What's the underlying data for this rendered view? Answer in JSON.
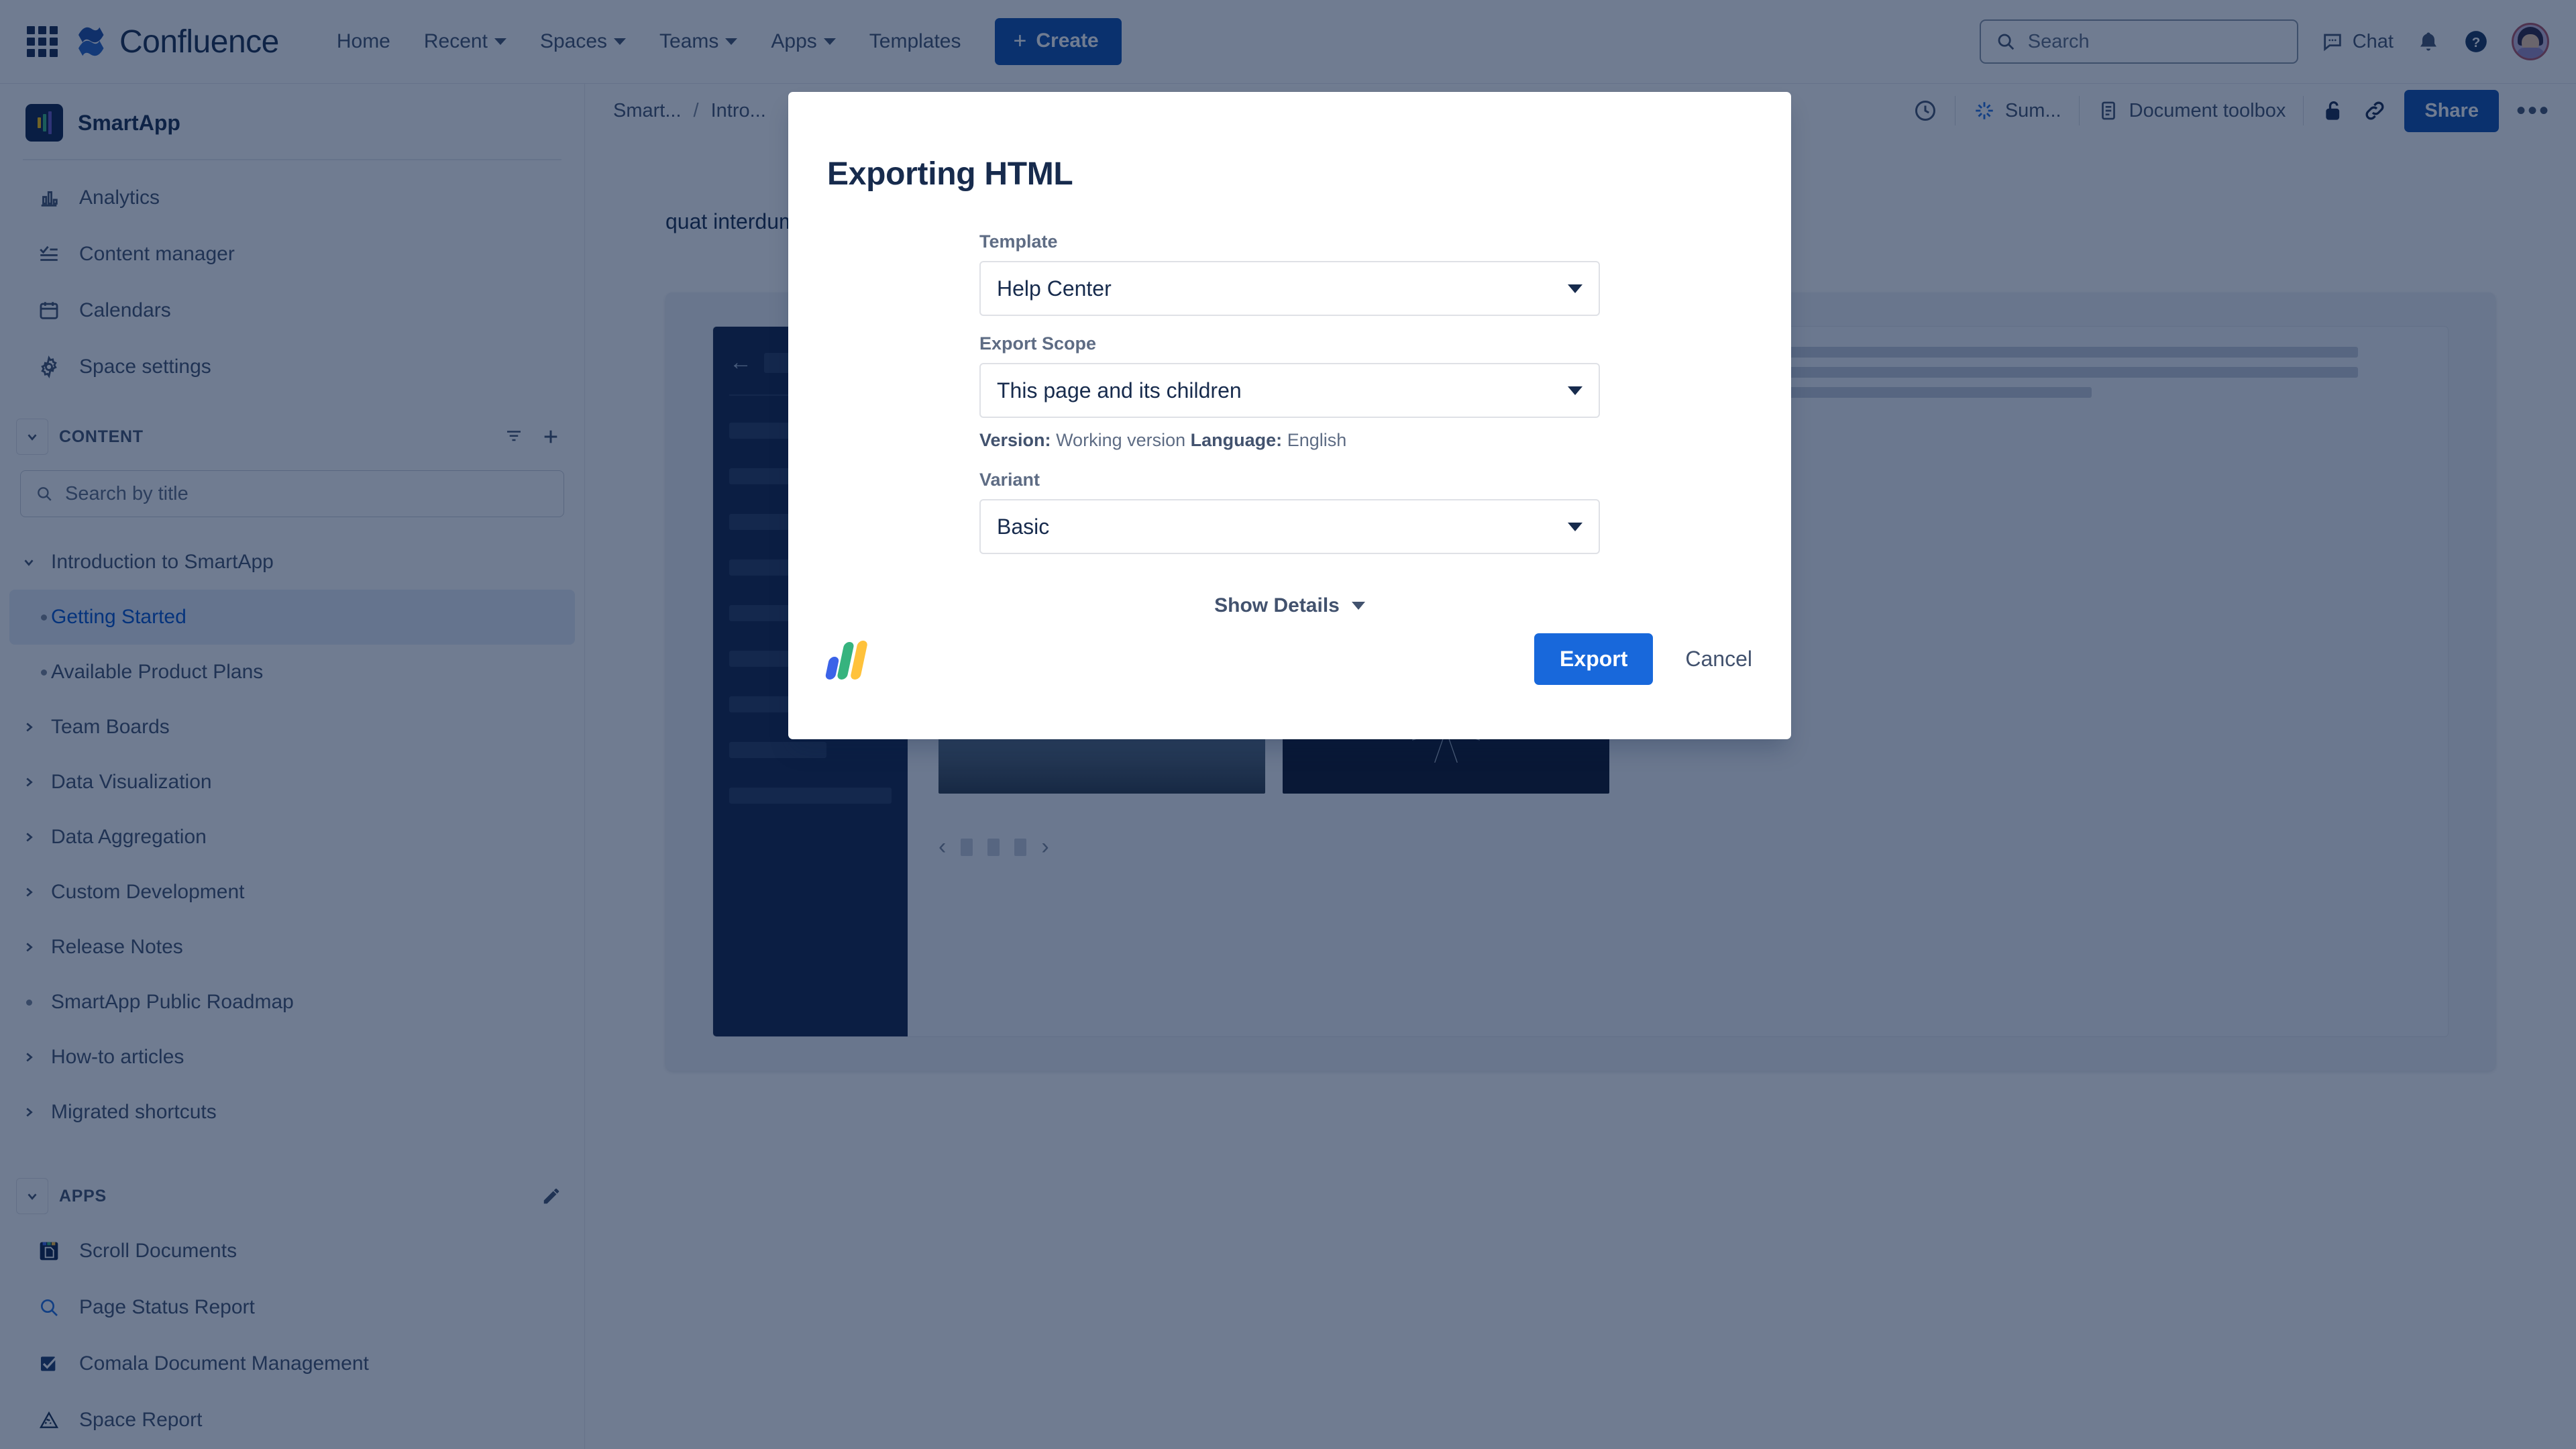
{
  "topnav": {
    "app_switcher_icon": "grid-icon",
    "brand": "Confluence",
    "items": [
      {
        "label": "Home",
        "has_caret": false
      },
      {
        "label": "Recent",
        "has_caret": true
      },
      {
        "label": "Spaces",
        "has_caret": true
      },
      {
        "label": "Teams",
        "has_caret": true
      },
      {
        "label": "Apps",
        "has_caret": true
      },
      {
        "label": "Templates",
        "has_caret": false
      }
    ],
    "create_label": "Create",
    "search_placeholder": "Search",
    "chat_label": "Chat",
    "notifications_icon": "notification-bell-icon",
    "help_icon": "help-circle-icon",
    "avatar_icon": "user-avatar"
  },
  "sidebar": {
    "space_name": "SmartApp",
    "nav": [
      {
        "label": "Analytics",
        "icon": "analytics-icon"
      },
      {
        "label": "Content manager",
        "icon": "content-manager-icon"
      },
      {
        "label": "Calendars",
        "icon": "calendar-icon"
      },
      {
        "label": "Space settings",
        "icon": "gear-icon"
      }
    ],
    "content_section_label": "CONTENT",
    "content_filter_icon": "filter-icon",
    "content_add_icon": "plus-icon",
    "search_placeholder": "Search by title",
    "tree": [
      {
        "label": "Introduction to SmartApp",
        "twisty": "chevron-down",
        "depth": 0,
        "selected": false
      },
      {
        "label": "Getting Started",
        "twisty": "bullet",
        "depth": 1,
        "selected": true
      },
      {
        "label": "Available Product Plans",
        "twisty": "bullet",
        "depth": 1,
        "selected": false
      },
      {
        "label": "Team Boards",
        "twisty": "chevron-right",
        "depth": 0,
        "selected": false
      },
      {
        "label": "Data Visualization",
        "twisty": "chevron-right",
        "depth": 0,
        "selected": false
      },
      {
        "label": "Data Aggregation",
        "twisty": "chevron-right",
        "depth": 0,
        "selected": false
      },
      {
        "label": "Custom Development",
        "twisty": "chevron-right",
        "depth": 0,
        "selected": false
      },
      {
        "label": "Release Notes",
        "twisty": "chevron-right",
        "depth": 0,
        "selected": false
      },
      {
        "label": "SmartApp Public Roadmap",
        "twisty": "bullet",
        "depth": 0,
        "selected": false
      },
      {
        "label": "How-to articles",
        "twisty": "chevron-right",
        "depth": 0,
        "selected": false
      },
      {
        "label": "Migrated shortcuts",
        "twisty": "chevron-right",
        "depth": 0,
        "selected": false
      }
    ],
    "apps_section_label": "APPS",
    "apps_edit_icon": "pencil-icon",
    "apps": [
      {
        "label": "Scroll Documents",
        "icon": "scroll-documents-icon"
      },
      {
        "label": "Page Status Report",
        "icon": "search-icon"
      },
      {
        "label": "Comala Document Management",
        "icon": "checkbox-icon"
      },
      {
        "label": "Space Report",
        "icon": "triangle-chart-icon"
      }
    ]
  },
  "pagebar": {
    "breadcrumbs": [
      "Smart...",
      "Intro..."
    ],
    "breadcrumb_separator": "/",
    "history_icon": "history-icon",
    "summarize_label": "Sum...",
    "summarize_icon": "ai-sparkle-icon",
    "document_toolbox_label": "Document toolbox",
    "document_toolbox_icon": "document-icon",
    "restrictions_icon": "unlock-icon",
    "copy_link_icon": "link-icon",
    "share_label": "Share",
    "more_icon": "more-dots-icon"
  },
  "content": {
    "paragraph": "quat interdum varius sit amet",
    "preview": {
      "back_icon": "arrow-left-icon",
      "pager_prev_icon": "chevron-left-icon",
      "pager_next_icon": "chevron-right-icon",
      "pager_dots": 3,
      "images": [
        {
          "name": "hammock-photo",
          "selected": true
        },
        {
          "name": "poster-photo",
          "selected": false
        },
        {
          "name": "fjord-photo",
          "selected": false
        },
        {
          "name": "firework-photo",
          "selected": false
        }
      ]
    }
  },
  "modal": {
    "title": "Exporting HTML",
    "fields": {
      "template_label": "Template",
      "template_value": "Help Center",
      "scope_label": "Export Scope",
      "scope_value": "This page and its children",
      "version_label": "Version:",
      "version_value": "Working version",
      "language_label": "Language:",
      "language_value": "English",
      "variant_label": "Variant",
      "variant_value": "Basic"
    },
    "show_details_label": "Show Details",
    "show_details_icon": "chevron-down-icon",
    "vendor_logo": "k15t-logo",
    "export_label": "Export",
    "cancel_label": "Cancel"
  },
  "colors": {
    "brand_blue": "#0052cc",
    "create_button": "#0c4dab",
    "export_button": "#1868db",
    "overlay": "rgba(9,30,66,0.58)",
    "selected_nav": "#e4ecf7",
    "logo_blue": "#3b63e8",
    "logo_green": "#36b37e",
    "logo_yellow": "#ffc23b",
    "selected_image_border": "#a93c4c"
  }
}
